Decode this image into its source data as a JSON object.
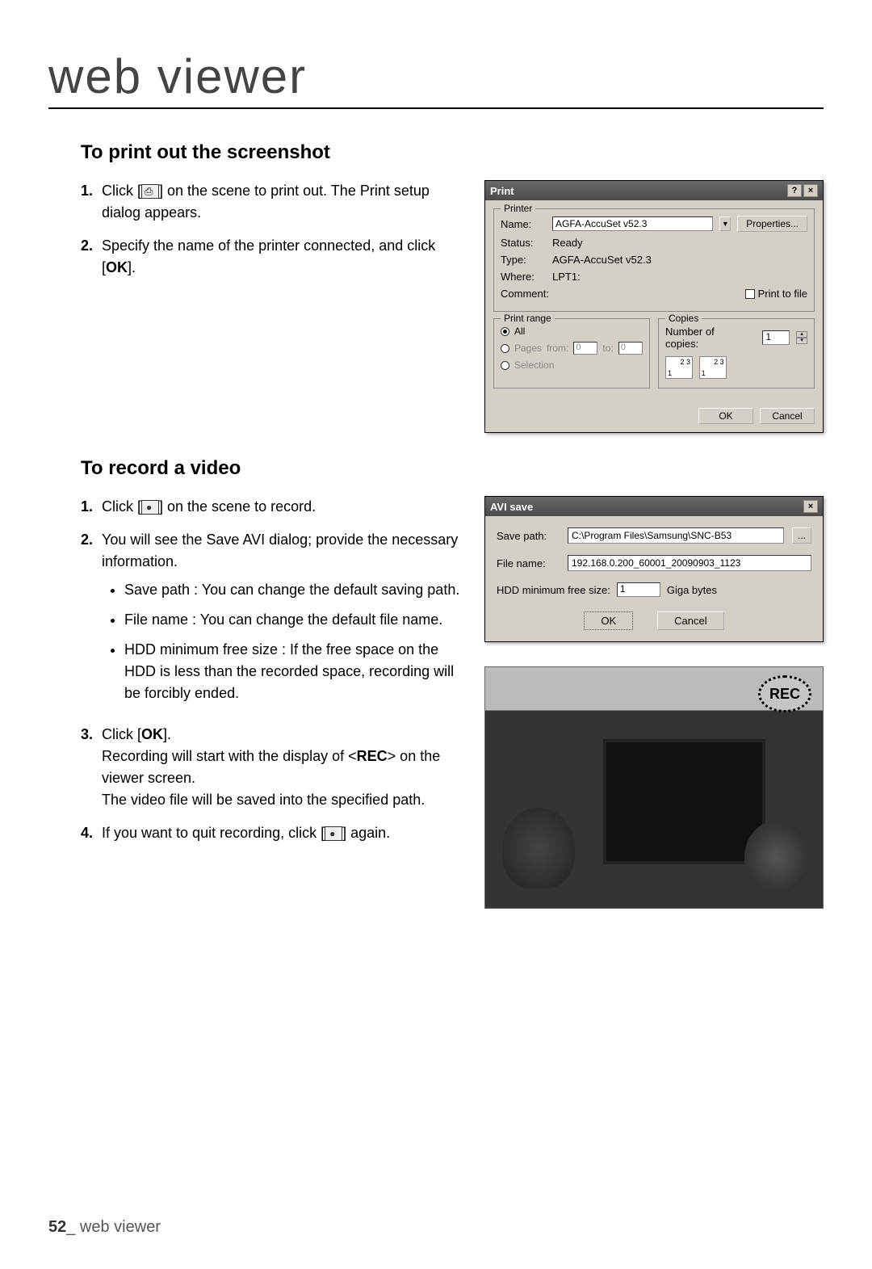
{
  "page": {
    "title": "web viewer",
    "footer_page": "52",
    "footer_label": " web viewer"
  },
  "section1": {
    "heading": "To print out the screenshot",
    "step1a": "Click [",
    "step1b": "] on the scene to print out. The Print setup dialog appears.",
    "step2a": "Specify the name of the printer connected, and click [",
    "step2_ok": "OK",
    "step2b": "]."
  },
  "print_dialog": {
    "title": "Print",
    "help_btn": "?",
    "close_btn": "×",
    "printer_legend": "Printer",
    "name_label": "Name:",
    "name_value": "AGFA-AccuSet v52.3",
    "properties_btn": "Properties...",
    "status_label": "Status:",
    "status_value": "Ready",
    "type_label": "Type:",
    "type_value": "AGFA-AccuSet v52.3",
    "where_label": "Where:",
    "where_value": "LPT1:",
    "comment_label": "Comment:",
    "print_to_file": "Print to file",
    "range_legend": "Print range",
    "range_all": "All",
    "range_pages": "Pages",
    "range_from": "from:",
    "range_from_val": "0",
    "range_to": "to:",
    "range_to_val": "0",
    "range_selection": "Selection",
    "copies_legend": "Copies",
    "num_copies_label": "Number of copies:",
    "num_copies_val": "1",
    "ok_btn": "OK",
    "cancel_btn": "Cancel"
  },
  "section2": {
    "heading": "To record a video",
    "step1a": "Click [",
    "step1b": "] on the scene to record.",
    "step2": "You will see the Save AVI dialog; provide the necessary information.",
    "bullet1": "Save path : You can change the default saving path.",
    "bullet2": "File name : You can change the default file name.",
    "bullet3": "HDD minimum free size : If the free space on the HDD is less than the recorded space, recording will be forcibly ended.",
    "step3a": "Click [",
    "step3_ok": "OK",
    "step3b": "].",
    "step3c": "Recording will start with the display of <",
    "step3_rec": "REC",
    "step3d": "> on the viewer screen.",
    "step3e": "The video file will be saved into the specified path.",
    "step4a": "If you want to quit recording, click [",
    "step4b": "] again."
  },
  "avi_dialog": {
    "title": "AVI save",
    "close_btn": "×",
    "save_path_label": "Save path:",
    "save_path_value": "C:\\Program Files\\Samsung\\SNC-B53",
    "browse_btn": "...",
    "file_name_label": "File name:",
    "file_name_value": "192.168.0.200_60001_20090903_1123",
    "hdd_label": "HDD minimum free size:",
    "hdd_value": "1",
    "hdd_unit": "Giga bytes",
    "ok_btn": "OK",
    "cancel_btn": "Cancel"
  },
  "video": {
    "rec_badge": "REC"
  }
}
